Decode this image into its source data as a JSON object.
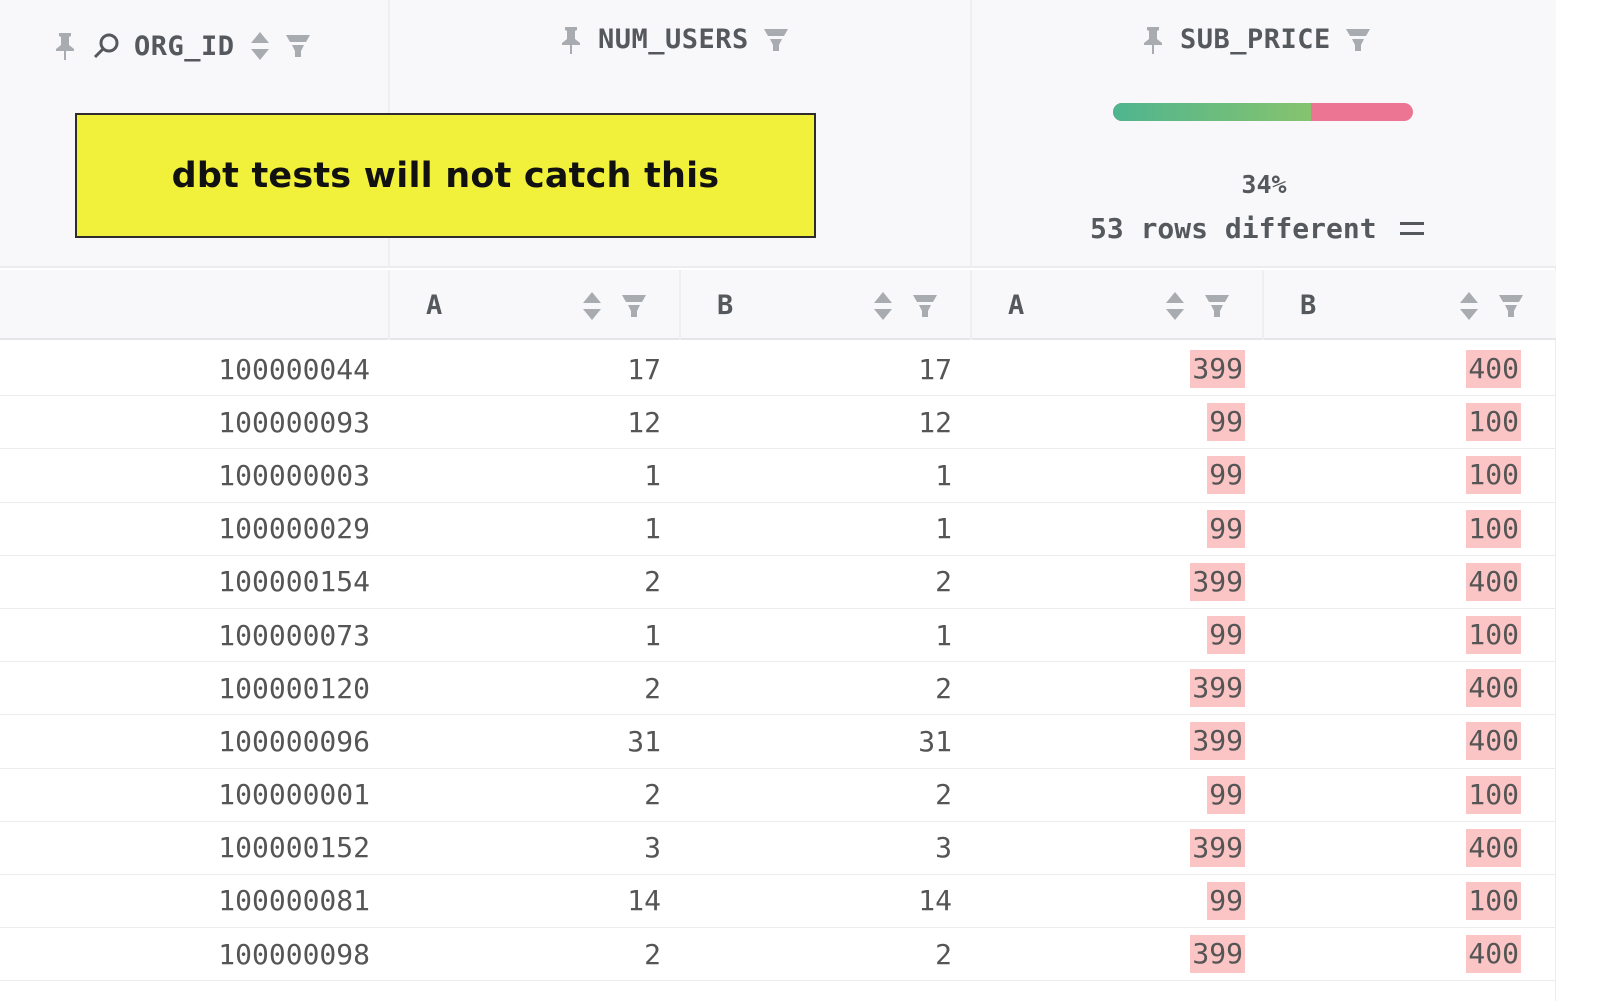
{
  "columns": {
    "org_id": "ORG_ID",
    "num_users": "NUM_USERS",
    "sub_price": "SUB_PRICE"
  },
  "sub_headers": [
    "A",
    "B",
    "A",
    "B"
  ],
  "callout": "dbt tests will not catch this",
  "diff_summary": {
    "percent": "34%",
    "percent_value": 0.66,
    "rows_different": "53 rows different"
  },
  "colors": {
    "match": "#4fb58f",
    "mismatch": "#ec7593",
    "diff_cell": "#fcc5c5",
    "callout_bg": "#f1f03a"
  },
  "rows": [
    {
      "org": "100000044",
      "ua": "17",
      "ub": "17",
      "pa": "399",
      "pb": "400"
    },
    {
      "org": "100000093",
      "ua": "12",
      "ub": "12",
      "pa": "99",
      "pb": "100"
    },
    {
      "org": "100000003",
      "ua": "1",
      "ub": "1",
      "pa": "99",
      "pb": "100"
    },
    {
      "org": "100000029",
      "ua": "1",
      "ub": "1",
      "pa": "99",
      "pb": "100"
    },
    {
      "org": "100000154",
      "ua": "2",
      "ub": "2",
      "pa": "399",
      "pb": "400"
    },
    {
      "org": "100000073",
      "ua": "1",
      "ub": "1",
      "pa": "99",
      "pb": "100"
    },
    {
      "org": "100000120",
      "ua": "2",
      "ub": "2",
      "pa": "399",
      "pb": "400"
    },
    {
      "org": "100000096",
      "ua": "31",
      "ub": "31",
      "pa": "399",
      "pb": "400"
    },
    {
      "org": "100000001",
      "ua": "2",
      "ub": "2",
      "pa": "99",
      "pb": "100"
    },
    {
      "org": "100000152",
      "ua": "3",
      "ub": "3",
      "pa": "399",
      "pb": "400"
    },
    {
      "org": "100000081",
      "ua": "14",
      "ub": "14",
      "pa": "99",
      "pb": "100"
    },
    {
      "org": "100000098",
      "ua": "2",
      "ub": "2",
      "pa": "399",
      "pb": "400"
    }
  ]
}
